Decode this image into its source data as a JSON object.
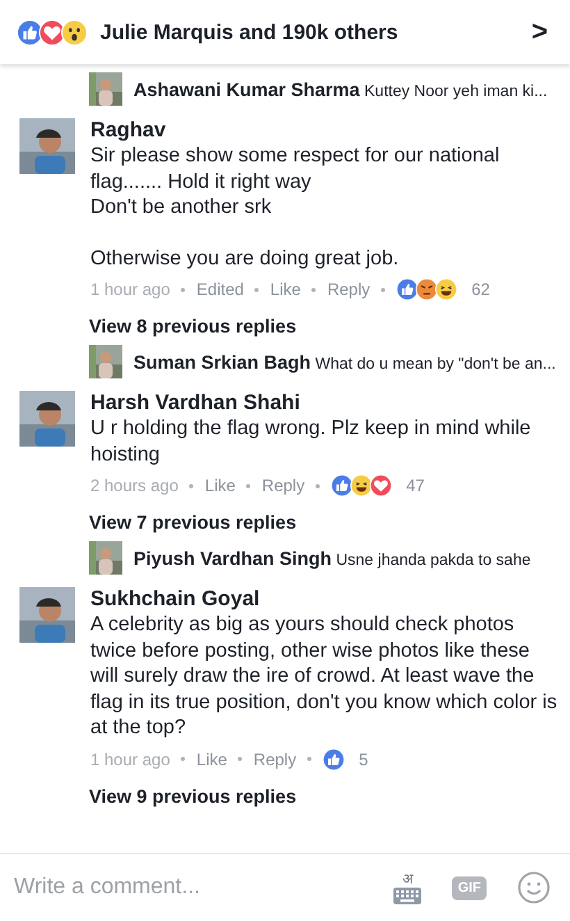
{
  "header": {
    "reactions": [
      {
        "kind": "like"
      },
      {
        "kind": "love"
      },
      {
        "kind": "wow"
      }
    ],
    "text": "Julie Marquis and 190k others",
    "chevron": ">"
  },
  "threads": [
    {
      "kind": "reply",
      "name": "Ashawani Kumar Sharma",
      "text": "Kuttey Noor yeh iman ki..."
    },
    {
      "kind": "comment",
      "name": "Raghav",
      "paragraphs": [
        "Sir please show some respect for our national flag....... Hold it right way\nDon't be another srk",
        "Otherwise you are doing great job."
      ],
      "meta": [
        "1 hour ago",
        "Edited",
        "Like",
        "Reply"
      ],
      "reactions": [
        {
          "kind": "like"
        },
        {
          "kind": "angry"
        },
        {
          "kind": "haha"
        }
      ],
      "count": "62"
    },
    {
      "kind": "more",
      "text": "View 8 previous replies"
    },
    {
      "kind": "reply",
      "name": "Suman Srkian Bagh",
      "text": "What do u mean by \"don't be an..."
    },
    {
      "kind": "comment",
      "name": "Harsh Vardhan Shahi",
      "paragraphs": [
        "U r holding the flag wrong. Plz keep in mind while hoisting"
      ],
      "meta": [
        "2 hours ago",
        "Like",
        "Reply"
      ],
      "reactions": [
        {
          "kind": "like"
        },
        {
          "kind": "haha"
        },
        {
          "kind": "love"
        }
      ],
      "count": "47"
    },
    {
      "kind": "more",
      "text": "View 7 previous replies"
    },
    {
      "kind": "reply",
      "name": "Piyush Vardhan Singh",
      "text": "Usne jhanda pakda to sahe"
    },
    {
      "kind": "comment",
      "name": "Sukhchain Goyal",
      "paragraphs": [
        "A celebrity as big as yours should check photos twice before posting, other wise photos like these will surely draw the ire of crowd. At least wave the flag in its true position, don't you know which color is at the top?"
      ],
      "meta": [
        "1 hour ago",
        "Like",
        "Reply"
      ],
      "reactions": [
        {
          "kind": "like"
        }
      ],
      "count": "5"
    },
    {
      "kind": "more",
      "text": "View 9 previous replies"
    }
  ],
  "composer": {
    "placeholder": "Write a comment...",
    "keyboard_label": "अ",
    "gif_label": "GIF"
  }
}
